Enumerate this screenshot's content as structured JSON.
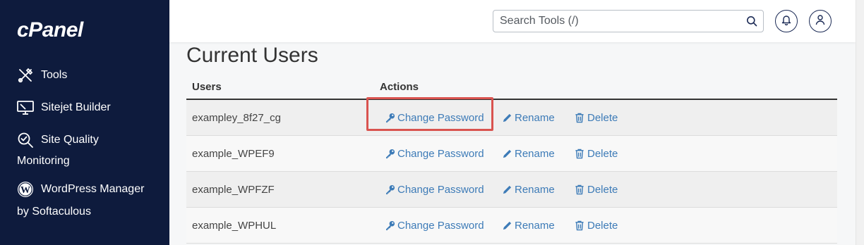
{
  "sidebar": {
    "logo": "cPanel",
    "items": [
      {
        "label": "Tools",
        "icon": "tools-icon"
      },
      {
        "label": "Sitejet Builder",
        "icon": "monitor-icon"
      },
      {
        "label_line1": "Site Quality",
        "label_line2": "Monitoring",
        "icon": "magnifier-check-icon"
      },
      {
        "label_line1": "WordPress Manager",
        "label_line2": "by Softaculous",
        "icon": "wordpress-icon"
      }
    ]
  },
  "topbar": {
    "search_placeholder": "Search Tools (/)",
    "search_icon": "search-icon",
    "notifications_icon": "bell-icon",
    "user_icon": "user-icon"
  },
  "main": {
    "title": "Current Users",
    "columns": {
      "users": "Users",
      "actions": "Actions"
    },
    "actions": {
      "change_password": "Change Password",
      "rename": "Rename",
      "delete": "Delete"
    },
    "rows": [
      {
        "user": "exampley_8f27_cg"
      },
      {
        "user": "example_WPEF9"
      },
      {
        "user": "example_WPFZF"
      },
      {
        "user": "example_WPHUL"
      }
    ]
  },
  "colors": {
    "sidebar_bg": "#0e1b3d",
    "link": "#3d7bb7",
    "highlight": "#d9534f"
  }
}
